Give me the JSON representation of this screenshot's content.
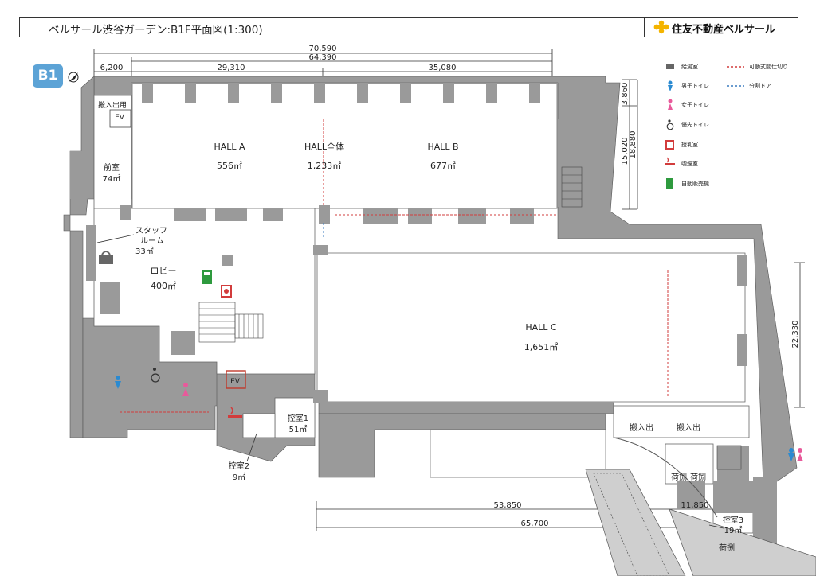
{
  "title": "ベルサール渋谷ガーデン:B1F平面図(1:300)",
  "brand": "住友不動産ベルサール",
  "floor_badge": "B1",
  "dimensions": {
    "top_total": "70,590",
    "top_mid": "64,390",
    "top_a": "6,200",
    "top_b": "29,310",
    "top_c": "35,080",
    "right_1": "3,860",
    "right_2": "15,020",
    "right_3": "18,880",
    "right_c": "22,330",
    "bottom_1": "53,850",
    "bottom_2": "11,850",
    "bottom_3": "65,700"
  },
  "rooms": {
    "hall_a": {
      "name": "HALL A",
      "area": "556㎡"
    },
    "hall_all": {
      "name": "HALL全体",
      "area": "1,233㎡"
    },
    "hall_b": {
      "name": "HALL B",
      "area": "677㎡"
    },
    "hall_c": {
      "name": "HALL C",
      "area": "1,651㎡"
    },
    "front": {
      "name": "前室",
      "area": "74㎡"
    },
    "staff": {
      "name1": "スタッフ",
      "name2": "ルーム",
      "area": "33㎡"
    },
    "lobby": {
      "name": "ロビー",
      "area": "400㎡"
    },
    "hikae1": {
      "name": "控室1",
      "area": "51㎡"
    },
    "hikae2": {
      "name": "控室2",
      "area": "9㎡"
    },
    "hikae3": {
      "name": "控室3",
      "area": "19㎡"
    },
    "hansyutsu_ev": "搬入出用",
    "ev": "EV",
    "ev2": "EV",
    "hansyutsu1": "搬入出",
    "hansyutsu2": "搬入出",
    "nidana1": "荷捌",
    "nidana2": "荷捌",
    "nidana3": "荷捌"
  },
  "legend": [
    {
      "icon": "kyutou-icon",
      "label": "給湯室"
    },
    {
      "icon": "mens-toilet-icon",
      "label": "男子トイレ"
    },
    {
      "icon": "womens-toilet-icon",
      "label": "女子トイレ"
    },
    {
      "icon": "accessible-toilet-icon",
      "label": "優先トイレ"
    },
    {
      "icon": "nursing-room-icon",
      "label": "授乳室"
    },
    {
      "icon": "smoking-room-icon",
      "label": "喫煙室"
    },
    {
      "icon": "vending-machine-icon",
      "label": "自動販売機"
    }
  ],
  "legend_lines": [
    {
      "label": "可動式間仕切り",
      "color": "#d23c3c"
    },
    {
      "label": "分割ドア",
      "color": "#3a7bbf"
    }
  ],
  "colors": {
    "wall": "#9a9a9a",
    "room": "#ffffff",
    "badge": "#5ca3d6",
    "movable": "#d23c3c",
    "split": "#3a7bbf"
  }
}
